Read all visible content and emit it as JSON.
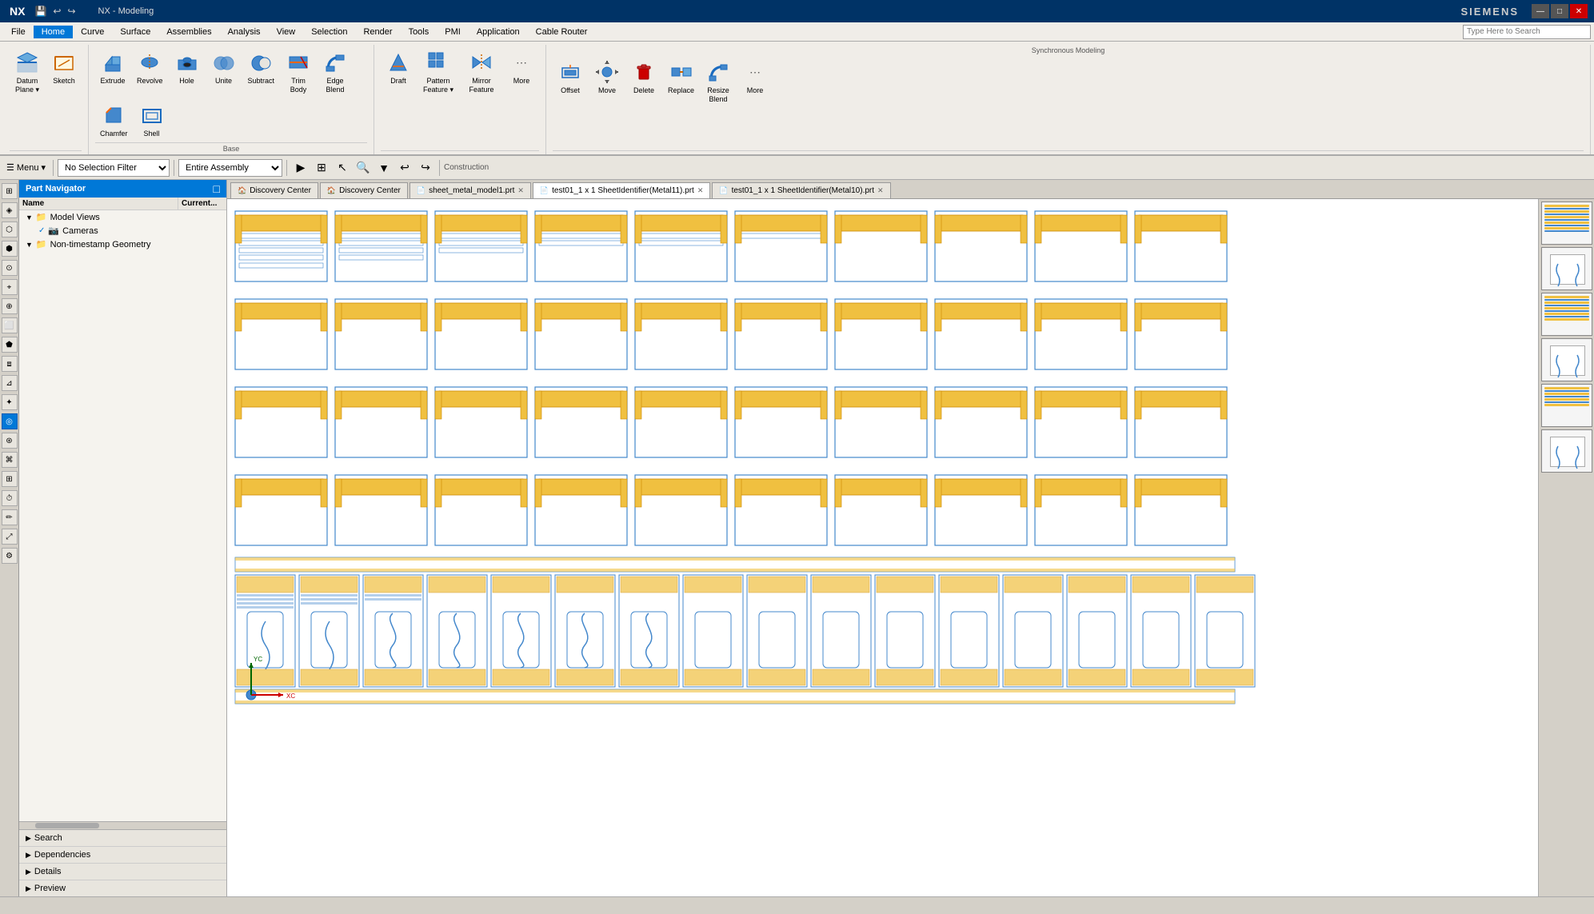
{
  "app": {
    "title": "NX - Modeling",
    "brand": "SIEMENS",
    "logo": "NX"
  },
  "titlebar": {
    "title": "NX - Modeling",
    "brand": "SIEMENS",
    "win_controls": [
      "—",
      "□",
      "✕"
    ]
  },
  "menubar": {
    "items": [
      "File",
      "Home",
      "Curve",
      "Surface",
      "Assemblies",
      "Analysis",
      "View",
      "Selection",
      "Render",
      "Tools",
      "PMI",
      "Application",
      "Cable Router"
    ]
  },
  "ribbon": {
    "active_tab": "Home",
    "groups": [
      {
        "label": "",
        "buttons": [
          {
            "id": "datum-plane",
            "icon": "⊡",
            "label": "Datum\nPlane",
            "color": "blue",
            "has_arrow": true
          },
          {
            "id": "sketch",
            "icon": "✏",
            "label": "Sketch",
            "color": "orange"
          }
        ]
      },
      {
        "label": "Base",
        "buttons": [
          {
            "id": "extrude",
            "icon": "⬛",
            "label": "Extrude",
            "color": "blue"
          },
          {
            "id": "revolve",
            "icon": "↻",
            "label": "Revolve",
            "color": "blue"
          },
          {
            "id": "hole",
            "icon": "⊙",
            "label": "Hole",
            "color": "blue"
          },
          {
            "id": "unite",
            "icon": "⊕",
            "label": "Unite",
            "color": "blue"
          },
          {
            "id": "subtract",
            "icon": "⊖",
            "label": "Subtract",
            "color": "blue"
          },
          {
            "id": "trim-body",
            "icon": "✂",
            "label": "Trim\nBody",
            "color": "blue"
          },
          {
            "id": "edge-blend",
            "icon": "⌒",
            "label": "Edge\nBlend",
            "color": "blue"
          },
          {
            "id": "chamfer",
            "icon": "◺",
            "label": "Chamfer",
            "color": "blue"
          },
          {
            "id": "shell",
            "icon": "⬜",
            "label": "Shell",
            "color": "blue"
          }
        ]
      },
      {
        "label": "",
        "buttons": [
          {
            "id": "draft",
            "icon": "◸",
            "label": "Draft",
            "color": "blue"
          },
          {
            "id": "pattern-feature",
            "icon": "⠿",
            "label": "Pattern\nFeature",
            "color": "blue",
            "has_arrow": true
          },
          {
            "id": "mirror-feature",
            "icon": "⇌",
            "label": "Mirror\nFeature",
            "color": "blue"
          },
          {
            "id": "more1",
            "icon": "⋯",
            "label": "More",
            "color": "gray"
          }
        ]
      },
      {
        "label": "Synchronous Modeling",
        "buttons": [
          {
            "id": "offset",
            "icon": "⤴",
            "label": "Offset",
            "color": "blue"
          },
          {
            "id": "move",
            "icon": "✥",
            "label": "Move",
            "color": "blue"
          },
          {
            "id": "delete",
            "icon": "🗑",
            "label": "Delete",
            "color": "red"
          },
          {
            "id": "replace",
            "icon": "↔",
            "label": "Replace",
            "color": "blue"
          },
          {
            "id": "resize-blend",
            "icon": "⌒",
            "label": "Resize\nBlend",
            "color": "blue"
          },
          {
            "id": "more2",
            "icon": "⋯",
            "label": "More",
            "color": "gray"
          }
        ]
      }
    ]
  },
  "toolbar": {
    "filter_label": "No Selection Filter",
    "assembly_label": "Entire Assembly",
    "construction_label": "Construction",
    "search_placeholder": "Type Here to Search"
  },
  "tabs": [
    {
      "id": "discovery1",
      "label": "Discovery Center",
      "closable": false
    },
    {
      "id": "discovery2",
      "label": "Discovery Center",
      "closable": false
    },
    {
      "id": "sheet-metal",
      "label": "sheet_metal_model1.prt",
      "closable": true,
      "active": false
    },
    {
      "id": "test01-11",
      "label": "test01_1 x 1 SheetIdentifier(Metal11).prt",
      "closable": true,
      "active": true
    },
    {
      "id": "test01-10",
      "label": "test01_1 x 1 SheetIdentifier(Metal10).prt",
      "closable": true,
      "active": false
    }
  ],
  "navigator": {
    "title": "Part Navigator",
    "columns": [
      "Name",
      "Current..."
    ],
    "tree": [
      {
        "id": "model-views",
        "level": 1,
        "label": "Model Views",
        "icon": "📁",
        "expanded": true
      },
      {
        "id": "cameras",
        "level": 2,
        "label": "Cameras",
        "icon": "📷",
        "checked": true
      },
      {
        "id": "non-timestamp",
        "level": 1,
        "label": "Non-timestamp Geometry",
        "icon": "📁",
        "expanded": true
      }
    ],
    "bottom_sections": [
      {
        "id": "search",
        "label": "Search"
      },
      {
        "id": "dependencies",
        "label": "Dependencies"
      },
      {
        "id": "details",
        "label": "Details"
      },
      {
        "id": "preview",
        "label": "Preview"
      }
    ]
  },
  "statusbar": {
    "message": ""
  },
  "coordinates": {
    "x": "XC",
    "y": "YC"
  },
  "right_panel": {
    "thumbnails": [
      {
        "id": "thumb1",
        "type": "lines"
      },
      {
        "id": "thumb2",
        "type": "white-box"
      },
      {
        "id": "thumb3",
        "type": "lines"
      },
      {
        "id": "thumb4",
        "type": "white-box"
      },
      {
        "id": "thumb5",
        "type": "lines"
      },
      {
        "id": "thumb6",
        "type": "white-box"
      }
    ]
  }
}
